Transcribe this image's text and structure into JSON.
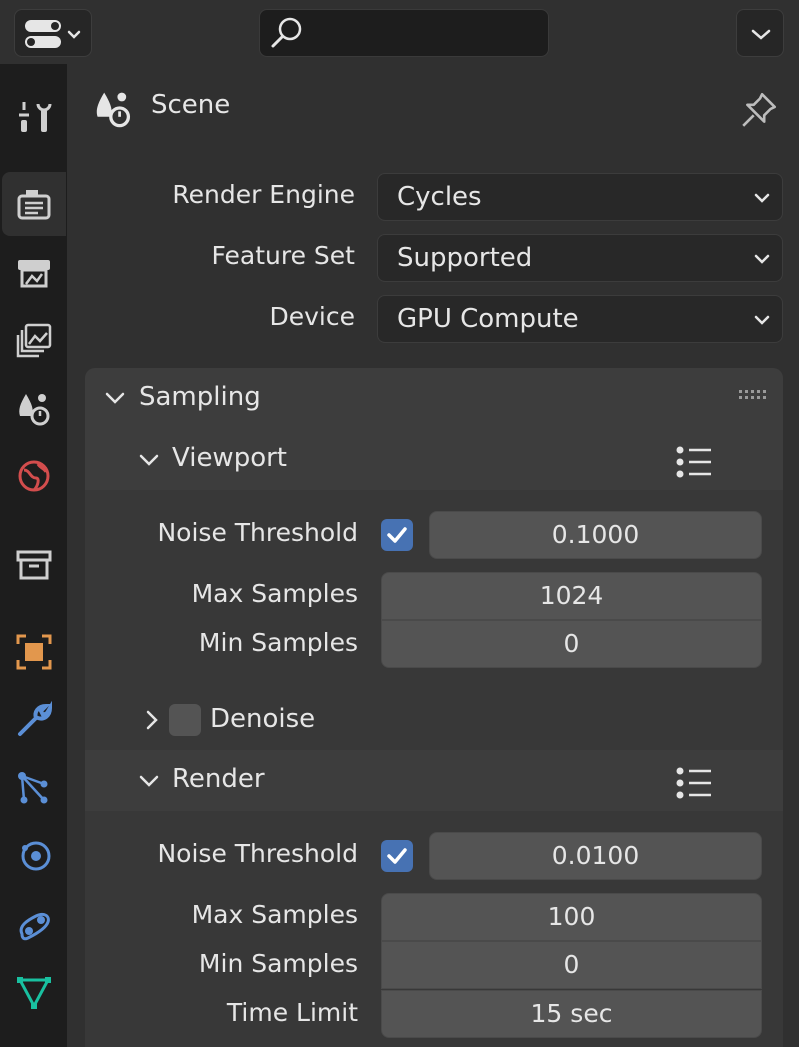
{
  "header": {
    "editor_type_icon": "editor-type-icon",
    "search_placeholder": "",
    "menu_icon": "chevron-down-icon"
  },
  "tabs": [
    {
      "name": "tool",
      "icon": "tool-icon",
      "color": "#cfcfcf"
    },
    {
      "name": "render",
      "icon": "render-icon",
      "color": "#cfcfcf",
      "active": true
    },
    {
      "name": "output",
      "icon": "output-icon",
      "color": "#cfcfcf"
    },
    {
      "name": "view-layer",
      "icon": "view-layer-icon",
      "color": "#cfcfcf"
    },
    {
      "name": "scene",
      "icon": "scene-icon",
      "color": "#cfcfcf"
    },
    {
      "name": "world",
      "icon": "world-icon",
      "color": "#d34d4d"
    },
    {
      "name": "collection",
      "icon": "collection-icon",
      "color": "#cfcfcf"
    },
    {
      "name": "object",
      "icon": "object-icon",
      "color": "#e2974d"
    },
    {
      "name": "modifiers",
      "icon": "wrench-icon",
      "color": "#5b8fd6"
    },
    {
      "name": "particles",
      "icon": "particles-icon",
      "color": "#5b8fd6"
    },
    {
      "name": "physics",
      "icon": "physics-icon",
      "color": "#5b8fd6"
    },
    {
      "name": "constraints",
      "icon": "constraints-icon",
      "color": "#5b8fd6"
    },
    {
      "name": "data",
      "icon": "mesh-data-icon",
      "color": "#19c0a0"
    }
  ],
  "breadcrumb": {
    "label": "Scene",
    "icon": "scene-icon"
  },
  "render_engine": {
    "label": "Render Engine",
    "value": "Cycles"
  },
  "feature_set": {
    "label": "Feature Set",
    "value": "Supported"
  },
  "device": {
    "label": "Device",
    "value": "GPU Compute"
  },
  "sampling": {
    "title": "Sampling",
    "viewport": {
      "title": "Viewport",
      "noise_threshold_label": "Noise Threshold",
      "noise_threshold_enabled": true,
      "noise_threshold": "0.1000",
      "max_samples_label": "Max Samples",
      "max_samples": "1024",
      "min_samples_label": "Min Samples",
      "min_samples": "0",
      "denoise_label": "Denoise",
      "denoise_enabled": false
    },
    "render": {
      "title": "Render",
      "noise_threshold_label": "Noise Threshold",
      "noise_threshold_enabled": true,
      "noise_threshold": "0.0100",
      "max_samples_label": "Max Samples",
      "max_samples": "100",
      "min_samples_label": "Min Samples",
      "min_samples": "0",
      "time_limit_label": "Time Limit",
      "time_limit": "15 sec"
    }
  },
  "colors": {
    "accent": "#4772b3",
    "panel": "#3d3d3d",
    "field": "#545454"
  }
}
